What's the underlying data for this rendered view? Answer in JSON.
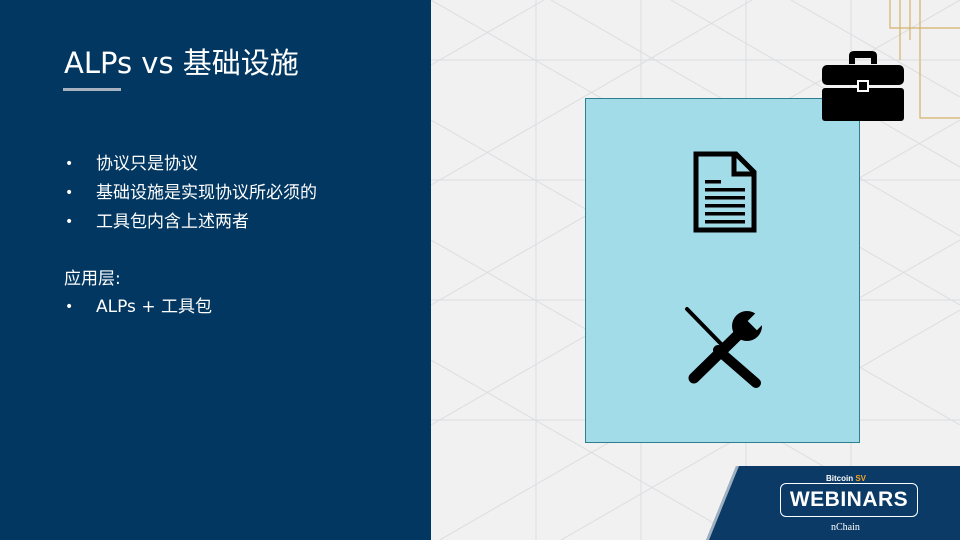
{
  "slide": {
    "title": "ALPs vs 基础设施",
    "bullets": [
      "协议只是协议",
      "基础设施是实现协议所必须的",
      "工具包内含上述两者"
    ],
    "section_label": "应用层:",
    "section_bullets": [
      "ALPs + 工具包"
    ],
    "bullet_glyph": "•"
  },
  "icons": {
    "briefcase": "briefcase-icon",
    "document": "document-icon",
    "tools": "tools-icon"
  },
  "badge": {
    "top_prefix": "Bitcoin ",
    "top_suffix": "SV",
    "main": "WEBINARS",
    "bottom": "nChain"
  },
  "colors": {
    "left_panel": "#023761",
    "right_panel": "#f1f1f2",
    "box_fill": "#a3dce9",
    "box_border": "#2d7f8f",
    "accent_gold": "#d4b26a",
    "badge_navy": "#0b3a66"
  }
}
